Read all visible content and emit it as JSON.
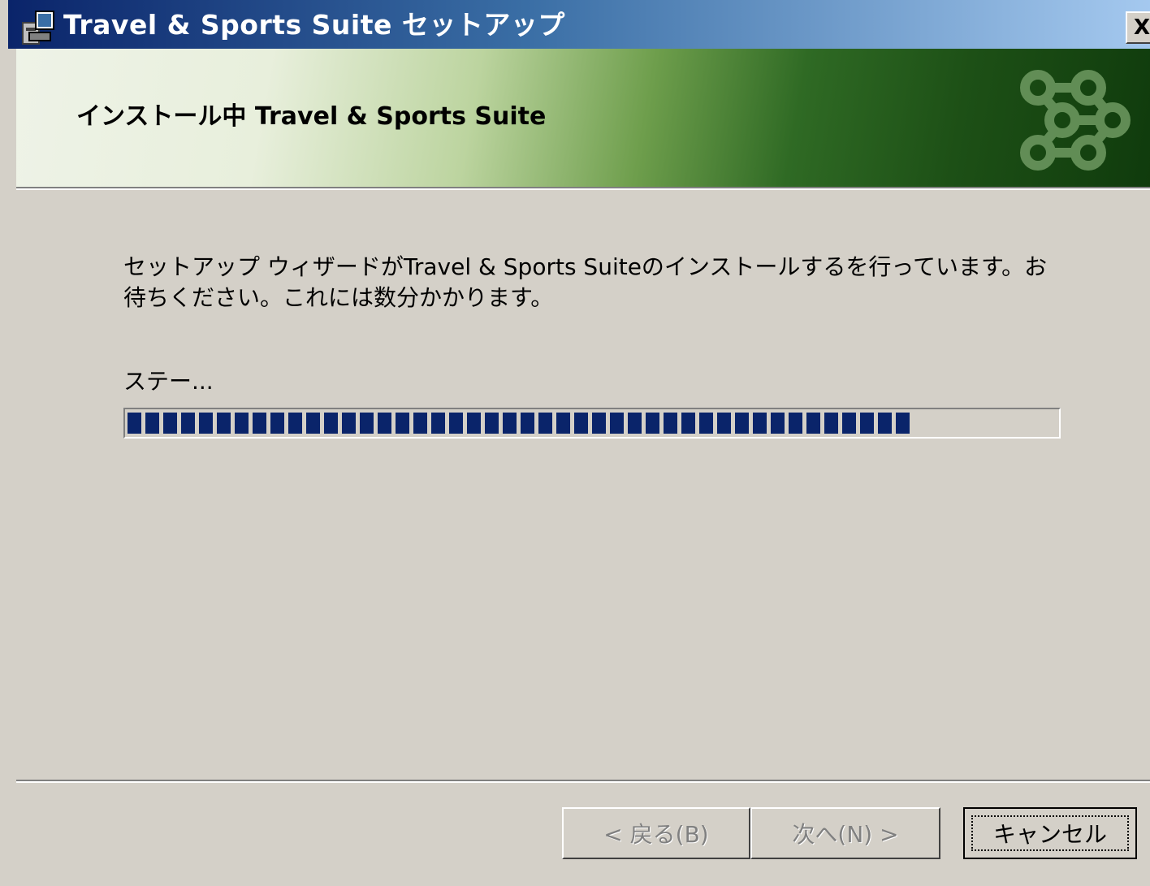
{
  "window": {
    "title": "Travel & Sports Suite セットアップ",
    "close_label": "X"
  },
  "banner": {
    "title": "インストール中 Travel & Sports Suite",
    "logo": "chain-rings-logo"
  },
  "main": {
    "description": "セットアップ ウィザードがTravel & Sports Suiteのインストールするを行っています。お待ちください。これには数分かかります。",
    "status_label": "ステー...",
    "progress": 0.86
  },
  "buttons": {
    "back_label": "< 戻る(B)",
    "next_label": "次へ(N) >",
    "cancel_label": "キャンセル"
  },
  "colors": {
    "title_bar_start": "#0a246a",
    "title_bar_end": "#a6caf0",
    "progress_fill": "#0a246a",
    "dialog_bg": "#d4d0c8"
  }
}
